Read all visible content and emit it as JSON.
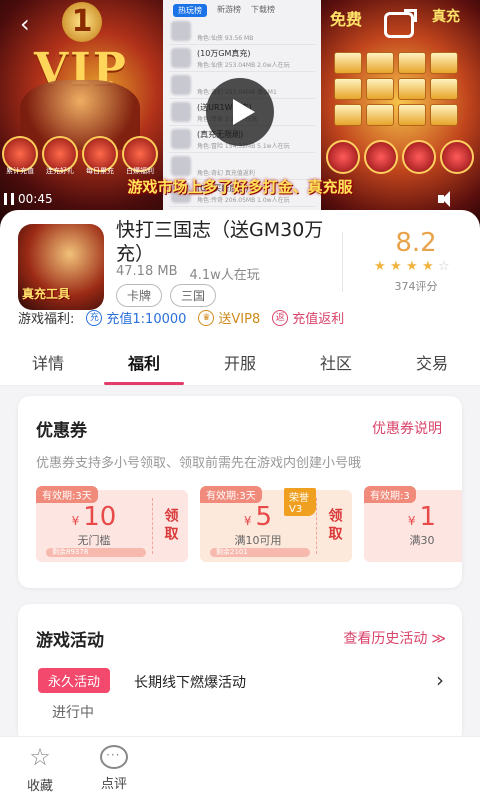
{
  "banner": {
    "vip_number": "1",
    "vip_text": "VIP",
    "left_caption": "仙秘天",
    "left_icons": [
      "累计充值",
      "连充好礼",
      "每日累充",
      "白嫖福利"
    ],
    "mid_tabs": [
      "热玩榜",
      "新游榜",
      "下载榜"
    ],
    "mid_rows": [
      {
        "title": "",
        "meta": "角色:仙侠    93.56 MB"
      },
      {
        "title": "(10万GM真充)",
        "meta": "角色:仙侠    253.04MB  2.0w人在玩"
      },
      {
        "title": "",
        "meta": "角色:奇幻    253.04MB  真GM1"
      },
      {
        "title": "(送UR1W真充)",
        "meta": "角色:传奇    3.2w人在玩"
      },
      {
        "title": "(真充无限刷)",
        "meta": "角色:冒险    154.32MB  5.1w人在玩"
      },
      {
        "title": "",
        "meta": "角色:奇幻    真充值返利"
      },
      {
        "title": "(GM买断后台)",
        "meta": "角色:传奇    206.05MB  1.0w人在玩"
      }
    ],
    "right_title_1": "免费",
    "right_title_2": "真充",
    "right_buttons": [
      "首充",
      "一亿元宝",
      "开局累充",
      "月卡"
    ],
    "caption": "游戏市场上多了好多打金、真充服",
    "time": "00:45"
  },
  "app": {
    "name": "快打三国志（送GM30万充）",
    "size": "47.18 MB",
    "players": "4.1w人在玩",
    "tags": [
      "卡牌",
      "三国"
    ],
    "icon_text": "真充工具",
    "score": "8.2",
    "stars": [
      1,
      1,
      1,
      1,
      0.5
    ],
    "rating_count": "374评分"
  },
  "benefits": {
    "label": "游戏福利:",
    "items": [
      {
        "icon": "充",
        "text": "充值1:10000"
      },
      {
        "icon": "♛",
        "text": "送VIP8"
      },
      {
        "icon": "返",
        "text": "充值返利"
      }
    ]
  },
  "tabs": [
    "详情",
    "福利",
    "开服",
    "社区",
    "交易"
  ],
  "active_tab": "福利",
  "coupons_section": {
    "title": "优惠券",
    "link": "优惠券说明",
    "desc": "优惠券支持多小号领取、领取前需先在游戏内创建小号哦",
    "coupons": [
      {
        "validity": "有效期:3天",
        "currency": "¥",
        "amount": "10",
        "condition": "无门槛",
        "remaining": "剩余89378",
        "claim": "领取",
        "vip": ""
      },
      {
        "validity": "有效期:3天",
        "currency": "¥",
        "amount": "5",
        "condition": "满10可用",
        "remaining": "剩余2101",
        "claim": "领取",
        "vip": "荣誉V3"
      },
      {
        "validity": "有效期:3",
        "currency": "¥",
        "amount": "1",
        "condition": "满30",
        "remaining": "",
        "claim": "",
        "vip": ""
      }
    ]
  },
  "activity_section": {
    "title": "游戏活动",
    "link": "查看历史活动",
    "link_arrow": "≫",
    "item": {
      "badge": "永久活动",
      "name": "长期线下燃爆活动",
      "status": "进行中",
      "chevron": "›"
    }
  },
  "bottom": {
    "favorite": "收藏",
    "review": "点评"
  }
}
